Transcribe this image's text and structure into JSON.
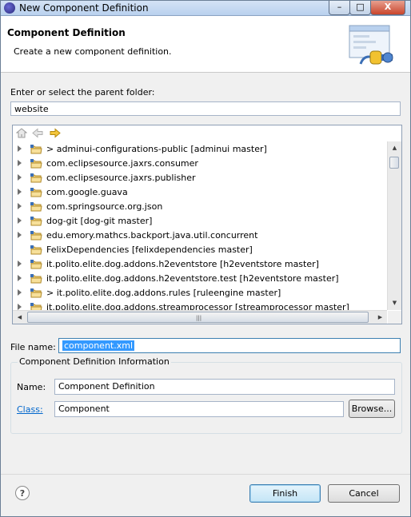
{
  "window": {
    "title": "New Component Definition"
  },
  "header": {
    "title": "Component Definition",
    "description": "Create a new component definition."
  },
  "parent_folder": {
    "label": "Enter or select the parent folder:",
    "value": "website"
  },
  "tree": {
    "items": [
      {
        "label": "> adminui-configurations-public  [adminui master]",
        "expandable": true
      },
      {
        "label": "com.eclipsesource.jaxrs.consumer",
        "expandable": true
      },
      {
        "label": "com.eclipsesource.jaxrs.publisher",
        "expandable": true
      },
      {
        "label": "com.google.guava",
        "expandable": true
      },
      {
        "label": "com.springsource.org.json",
        "expandable": true
      },
      {
        "label": "dog-git  [dog-git master]",
        "expandable": true
      },
      {
        "label": "edu.emory.mathcs.backport.java.util.concurrent",
        "expandable": true
      },
      {
        "label": "FelixDependencies  [felixdependencies master]",
        "expandable": false
      },
      {
        "label": "it.polito.elite.dog.addons.h2eventstore  [h2eventstore master]",
        "expandable": true
      },
      {
        "label": "it.polito.elite.dog.addons.h2eventstore.test  [h2eventstore master]",
        "expandable": true
      },
      {
        "label": "> it.polito.elite.dog.addons.rules  [ruleengine master]",
        "expandable": true
      },
      {
        "label": "it.polito.elite.dog.addons.streamprocessor  [streamprocessor master]",
        "expandable": true
      }
    ]
  },
  "file_name": {
    "label": "File name:",
    "value": "component.xml"
  },
  "info_group": {
    "title": "Component Definition Information",
    "name_label": "Name:",
    "name_value": "Component Definition",
    "class_label": "Class:",
    "class_value": "Component",
    "browse_label": "Browse..."
  },
  "footer": {
    "help_glyph": "?",
    "finish_label": "Finish",
    "cancel_label": "Cancel"
  },
  "title_buttons": {
    "minimize": "–",
    "maximize": "□",
    "close": "X"
  }
}
